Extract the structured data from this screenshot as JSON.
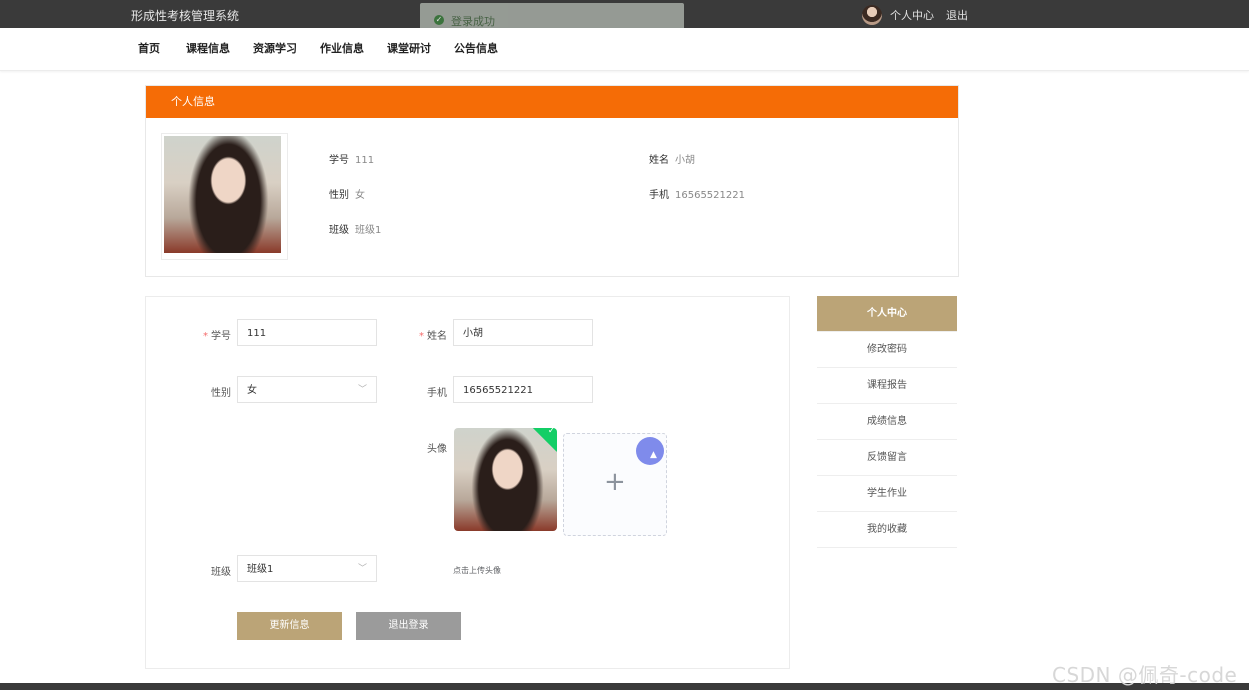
{
  "header": {
    "brand": "形成性考核管理系统",
    "user_center": "个人中心",
    "logout": "退出"
  },
  "toast": {
    "message": "登录成功"
  },
  "nav": {
    "items": [
      "首页",
      "课程信息",
      "资源学习",
      "作业信息",
      "课堂研讨",
      "公告信息"
    ]
  },
  "profile": {
    "title": "个人信息",
    "student_id": {
      "label": "学号",
      "value": "111"
    },
    "name": {
      "label": "姓名",
      "value": "小胡"
    },
    "gender": {
      "label": "性别",
      "value": "女"
    },
    "phone": {
      "label": "手机",
      "value": "16565521221"
    },
    "class": {
      "label": "班级",
      "value": "班级1"
    }
  },
  "form": {
    "student_id": {
      "required": "*",
      "label": "学号",
      "value": "111"
    },
    "name": {
      "required": "*",
      "label": "姓名",
      "value": "小胡"
    },
    "gender": {
      "label": "性别",
      "value": "女"
    },
    "phone": {
      "label": "手机",
      "value": "16565521221"
    },
    "avatar": {
      "label": "头像",
      "hint": "点击上传头像"
    },
    "class": {
      "label": "班级",
      "value": "班级1"
    },
    "update_button": "更新信息",
    "logout_button": "退出登录"
  },
  "sidebar": {
    "items": [
      "个人中心",
      "修改密码",
      "课程报告",
      "成绩信息",
      "反馈留言",
      "学生作业",
      "我的收藏"
    ]
  },
  "watermark": "CSDN @佩奇-code",
  "colors": {
    "topbar": "#3a3a3a",
    "profile_header": "#f56c06",
    "accent_gold": "#bba477",
    "secondary_button": "#9b9b9b",
    "success": "#13ce66",
    "required_star": "#f56c6c"
  }
}
